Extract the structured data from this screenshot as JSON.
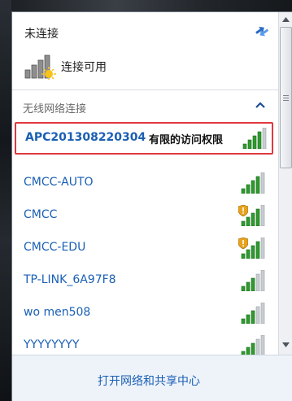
{
  "header": {
    "status": "未连接",
    "available": "连接可用"
  },
  "section": {
    "title": "无线网络连接"
  },
  "networks": [
    {
      "name": "APC201308220304",
      "status": "有限的访问权限",
      "signal": 4,
      "secured": false,
      "selected": true
    },
    {
      "name": "CMCC-AUTO",
      "status": "",
      "signal": 4,
      "secured": false
    },
    {
      "name": "CMCC",
      "status": "",
      "signal": 4,
      "secured": true
    },
    {
      "name": "CMCC-EDU",
      "status": "",
      "signal": 4,
      "secured": true
    },
    {
      "name": "TP-LINK_6A97F8",
      "status": "",
      "signal": 3,
      "secured": false
    },
    {
      "name": "wo men508",
      "status": "",
      "signal": 3,
      "secured": false
    },
    {
      "name": "YYYYYYYY",
      "status": "",
      "signal": 3,
      "secured": false
    }
  ],
  "footer": {
    "link": "打开网络和共享中心"
  },
  "colors": {
    "link": "#1a5fb4",
    "signal_on": "#2f9a2f",
    "signal_off": "#c9cdd2",
    "selection_border": "#e0383e",
    "shield": "#e8a21c"
  }
}
